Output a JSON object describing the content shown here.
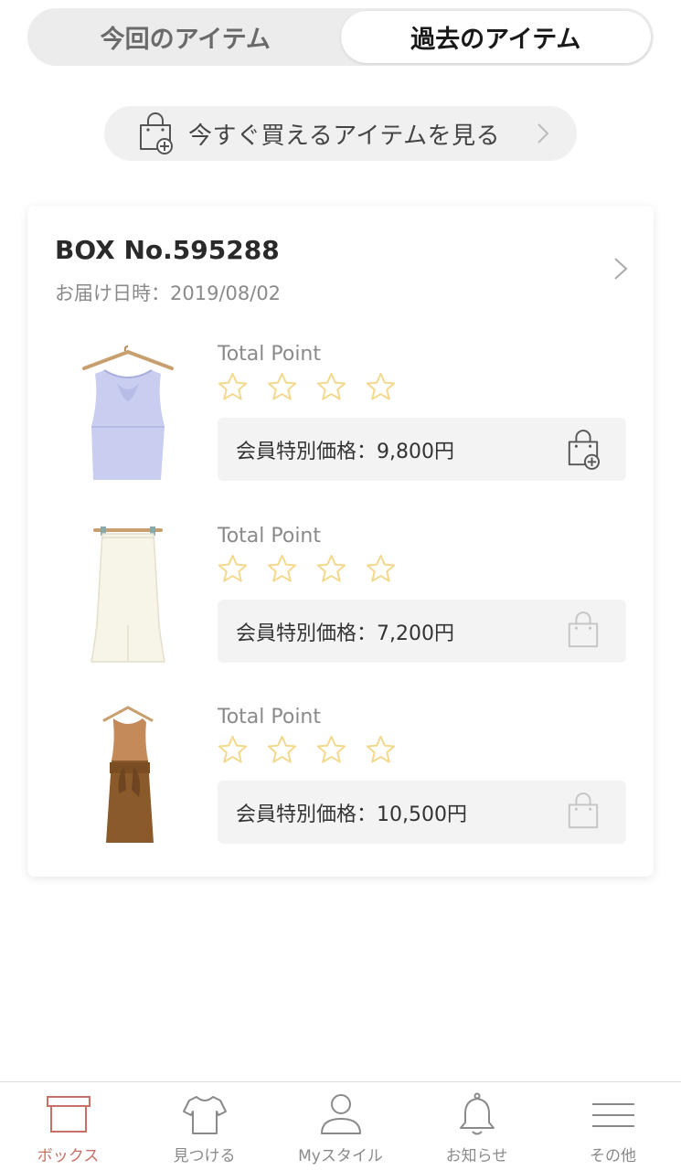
{
  "segment": {
    "current_label": "今回のアイテム",
    "past_label": "過去のアイテム"
  },
  "buy_now": {
    "label": "今すぐ買えるアイテムを見る"
  },
  "box": {
    "title": "BOX No.595288",
    "delivery_date": "お届け日時：2019/08/02",
    "items": [
      {
        "name": "lavender-sleeveless-blouse",
        "total_point_label": "Total Point",
        "rating": 0,
        "price": "会員特別価格：9,800円",
        "purchasable": true
      },
      {
        "name": "white-pencil-skirt",
        "total_point_label": "Total Point",
        "rating": 0,
        "price": "会員特別価格：7,200円",
        "purchasable": false
      },
      {
        "name": "brown-sleeveless-dress",
        "total_point_label": "Total Point",
        "rating": 0,
        "price": "会員特別価格：10,500円",
        "purchasable": false
      }
    ]
  },
  "tabbar": {
    "box_label": "ボックス",
    "find_label": "見つける",
    "mystyle_label": "Myスタイル",
    "news_label": "お知らせ",
    "other_label": "その他"
  },
  "colors": {
    "accent": "#c86f66",
    "star": "#f3d98e",
    "muted": "#8a8a8a"
  }
}
